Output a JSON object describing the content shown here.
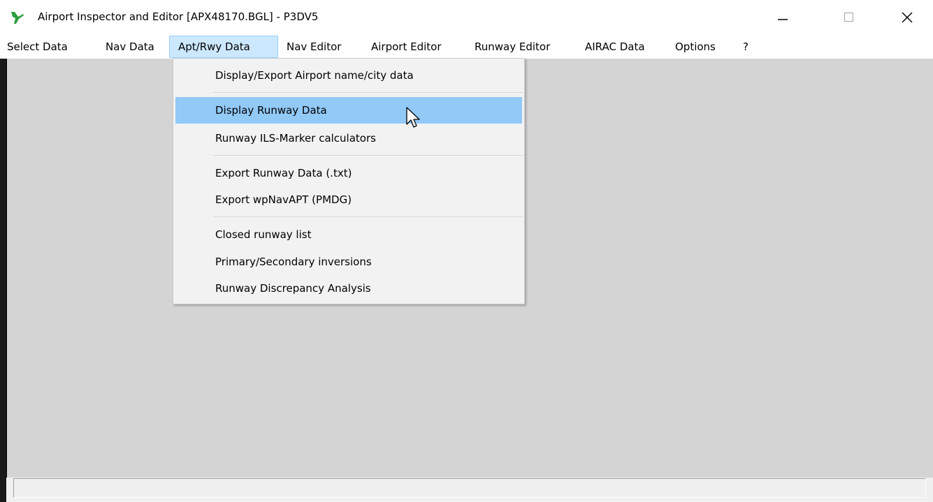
{
  "window": {
    "title": "Airport Inspector and Editor [APX48170.BGL] - P3DV5",
    "app_icon": "airplane-takeoff-icon",
    "controls": [
      "minimize-icon",
      "maximize-icon",
      "close-icon"
    ]
  },
  "menubar": {
    "items": [
      {
        "label": "Select Data"
      },
      {
        "label": "Nav Data"
      },
      {
        "label": "Apt/Rwy Data",
        "active": true
      },
      {
        "label": "Nav Editor"
      },
      {
        "label": "Airport Editor"
      },
      {
        "label": "Runway Editor"
      },
      {
        "label": "AIRAC Data"
      },
      {
        "label": "Options"
      },
      {
        "label": "?"
      }
    ]
  },
  "dropdown": {
    "items": [
      {
        "label": "Display/Export Airport name/city data"
      },
      {
        "label": "Display Runway Data",
        "highlighted": true
      },
      {
        "label": "Runway ILS-Marker calculators"
      },
      {
        "label": "Export Runway Data (.txt)"
      },
      {
        "label": "Export wpNavAPT (PMDG)"
      },
      {
        "label": "Closed runway list"
      },
      {
        "label": "Primary/Secondary inversions"
      },
      {
        "label": "Runway Discrepancy Analysis"
      }
    ]
  },
  "statusbar": {
    "text": ""
  },
  "colors": {
    "menu_active_bg": "#cce8ff",
    "menu_highlight_bg": "#91c9f7",
    "client_bg": "#d4d4d4",
    "icon_green": "#2e9e3e"
  }
}
